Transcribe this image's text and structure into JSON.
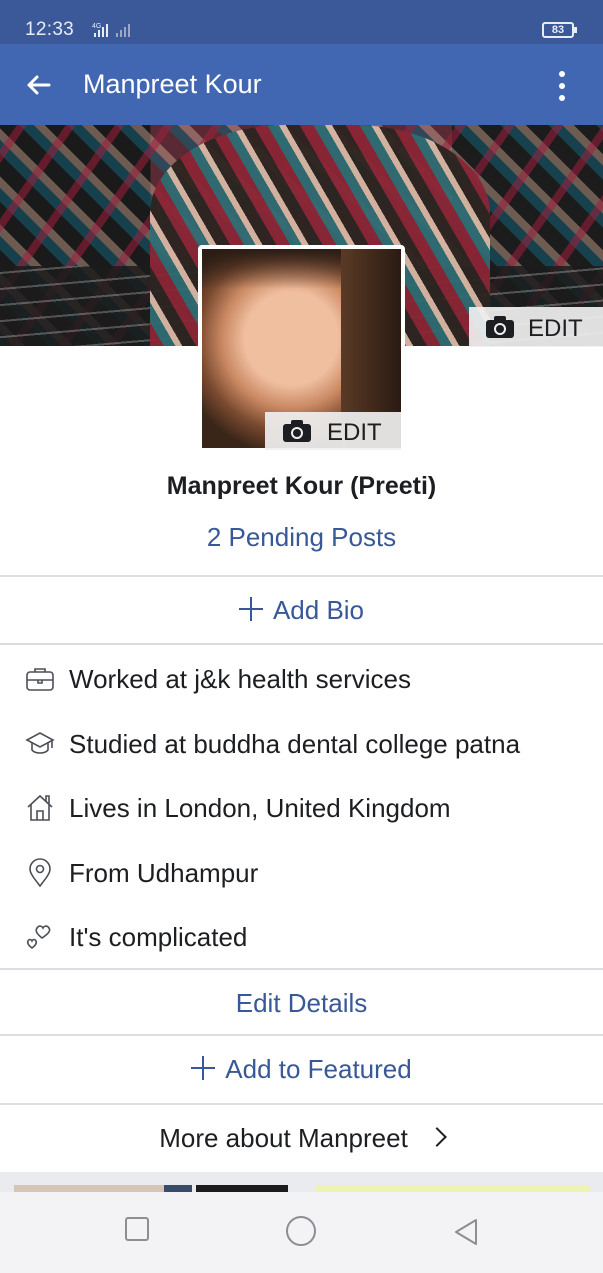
{
  "status_bar": {
    "time": "12:33",
    "network": "4G",
    "battery": "83"
  },
  "app_bar": {
    "title": "Manpreet Kour"
  },
  "cover": {
    "edit_label": "EDIT"
  },
  "profile_photo": {
    "edit_label": "EDIT"
  },
  "profile": {
    "name": "Manpreet Kour (Preeti)",
    "pending_posts": "2 Pending Posts"
  },
  "actions": {
    "add_bio": "Add Bio",
    "edit_details": "Edit Details",
    "add_featured": "Add to Featured",
    "more_about": "More about Manpreet"
  },
  "details": [
    {
      "icon": "briefcase-icon",
      "text": "Worked at j&k health services"
    },
    {
      "icon": "graduation-cap-icon",
      "text": "Studied at buddha dental college patna"
    },
    {
      "icon": "home-icon",
      "text": "Lives in London, United Kingdom"
    },
    {
      "icon": "location-pin-icon",
      "text": "From Udhampur"
    },
    {
      "icon": "hearts-icon",
      "text": "It's complicated"
    }
  ],
  "colors": {
    "brand_blue": "#4267b2",
    "status_blue": "#3b5998",
    "link_blue": "#385898",
    "divider": "#dadde1"
  }
}
